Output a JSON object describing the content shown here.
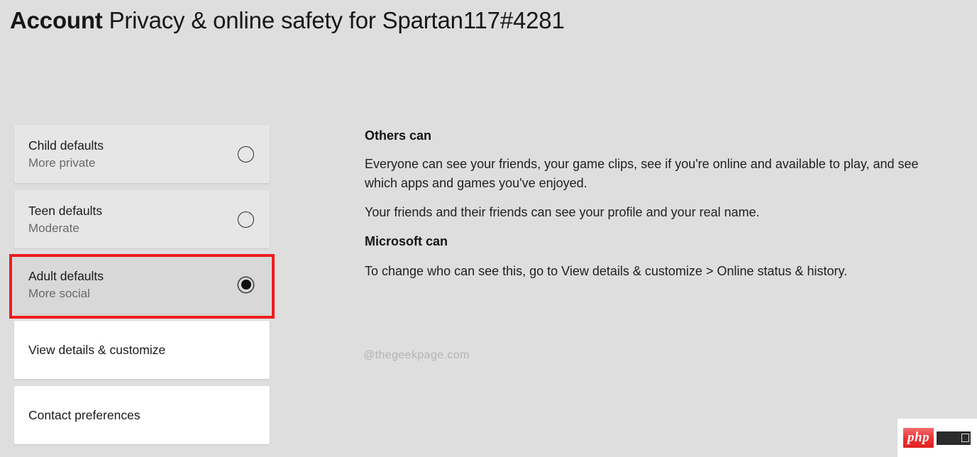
{
  "header": {
    "bold_prefix": "Account",
    "rest": " Privacy & online safety for Spartan117#4281"
  },
  "options": {
    "items": [
      {
        "title": "Child defaults",
        "subtitle": "More private",
        "selected": false,
        "style": "gray",
        "radio": "radio-unselected"
      },
      {
        "title": "Teen defaults",
        "subtitle": "Moderate",
        "selected": false,
        "style": "gray",
        "radio": "radio-unselected"
      },
      {
        "title": "Adult defaults",
        "subtitle": "More social",
        "selected": true,
        "style": "gray-selected",
        "radio": "radio-selected",
        "highlighted": true
      },
      {
        "title": "View details & customize",
        "subtitle": "",
        "selected": false,
        "style": "white",
        "radio": "none"
      },
      {
        "title": "Contact preferences",
        "subtitle": "",
        "selected": false,
        "style": "white",
        "radio": "none"
      }
    ]
  },
  "info": {
    "others_heading": "Others can",
    "others_para_1": "Everyone can see your friends, your game clips, see if you're online and available to play, and see which apps and games you've enjoyed.",
    "others_para_2": "Your friends and their friends can see your profile and your real name.",
    "microsoft_heading": "Microsoft can",
    "microsoft_para": "To change who can see this, go to View details & customize > Online status & history."
  },
  "watermark": {
    "text": "@thegeekpage.com"
  },
  "badge": {
    "php_label": "php"
  },
  "colors": {
    "page_background": "#dedede",
    "card_gray": "#e6e6e6",
    "card_selected_gray": "#d8d8d8",
    "card_white": "#ffffff",
    "highlight_red": "#ef1c1c",
    "text_primary": "#1a1a1a",
    "text_secondary": "#6a6a6a",
    "watermark_gray": "#b4b4b4",
    "php_red": "#ee2f2f"
  }
}
